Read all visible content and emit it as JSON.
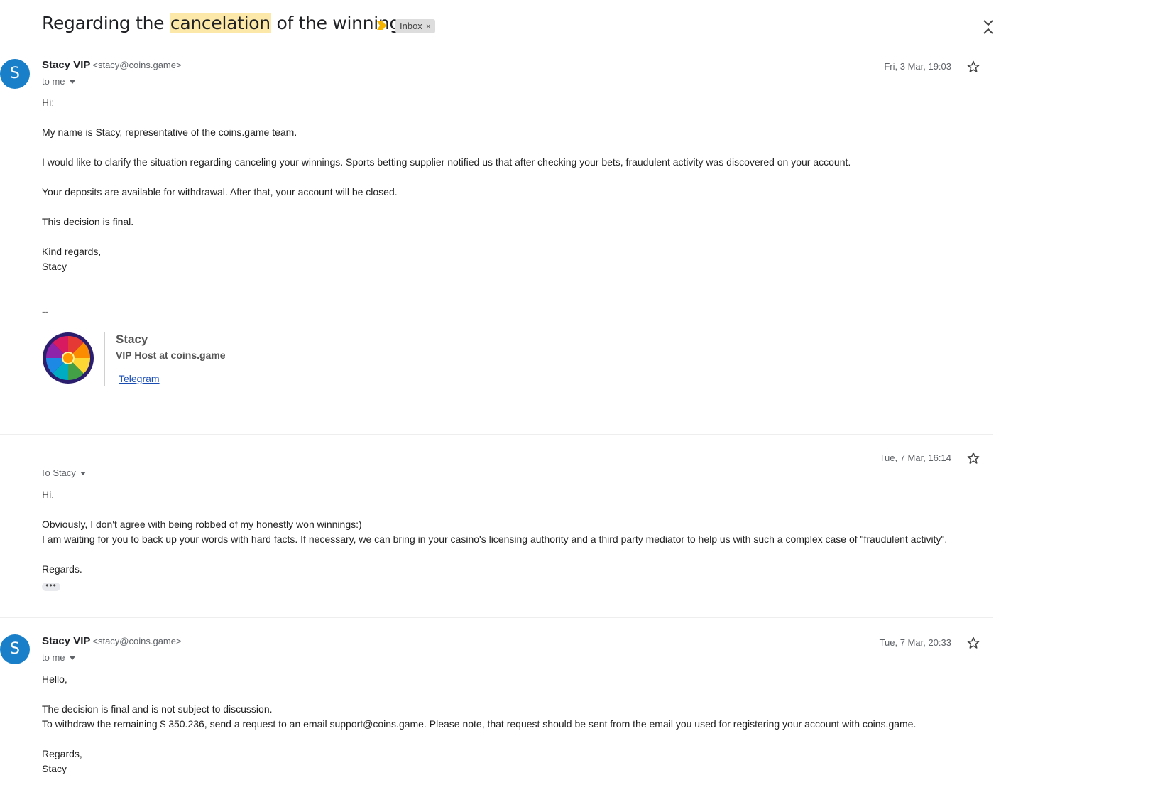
{
  "thread": {
    "subject_before": "Regarding the ",
    "subject_highlight": "cancelation",
    "subject_after": " of the winnings.",
    "label": "Inbox",
    "label_remove": "×"
  },
  "messages": [
    {
      "avatar_letter": "S",
      "sender_name": "Stacy VIP",
      "sender_email": "<stacy@coins.game>",
      "recipient": "to me",
      "date": "Fri, 3 Mar, 19:03",
      "body": [
        "Hiː",
        "My name is Stacy, representative of the coins.game team.",
        "I would like to clarify the situation regarding canceling your winnings. Sports betting supplier notified us that after checking your bets, fraudulent activity was discovered on your account.",
        "Your deposits are available for withdrawal. After that, your account will be closed.",
        "This decision is final.",
        "Kind regards,",
        "Stacy",
        "--"
      ],
      "signature": {
        "name": "Stacy",
        "title": "VIP Host at coins.game",
        "link": "Telegram"
      }
    },
    {
      "recipient": "To Stacy",
      "date": "Tue, 7 Mar, 16:14",
      "body": [
        "Hi.",
        "Obviously, I don't agree with being robbed of my honestly won winnings:)",
        "I am waiting for you to back up your words with hard facts. If necessary, we can bring in your casino's licensing authority and a third party mediator to help us with such a complex case of \"fraudulent activity\".",
        "Regards."
      ],
      "trimmed_indicator": "•••"
    },
    {
      "avatar_letter": "S",
      "sender_name": "Stacy VIP",
      "sender_email": "<stacy@coins.game>",
      "recipient": "to me",
      "date": "Tue, 7 Mar, 20:33",
      "body": [
        "Hello,",
        "The decision is final and is not subject to discussion.",
        "To withdraw the remaining $ 350.236, send a request to an email support@coins.game. Please note, that request should be sent from the email you used for registering your account with coins.game.",
        "Regards,",
        "Stacy"
      ]
    }
  ],
  "colors": {
    "avatar": "#1a7fc9",
    "highlight": "#fce8a8",
    "important_marker": "#f4b400",
    "link": "#1a4db3"
  },
  "icons": [
    "important-marker-icon",
    "close-label-icon",
    "collapse-all-icon",
    "star-icon",
    "dropdown-caret-icon",
    "wheel-logo-icon"
  ]
}
